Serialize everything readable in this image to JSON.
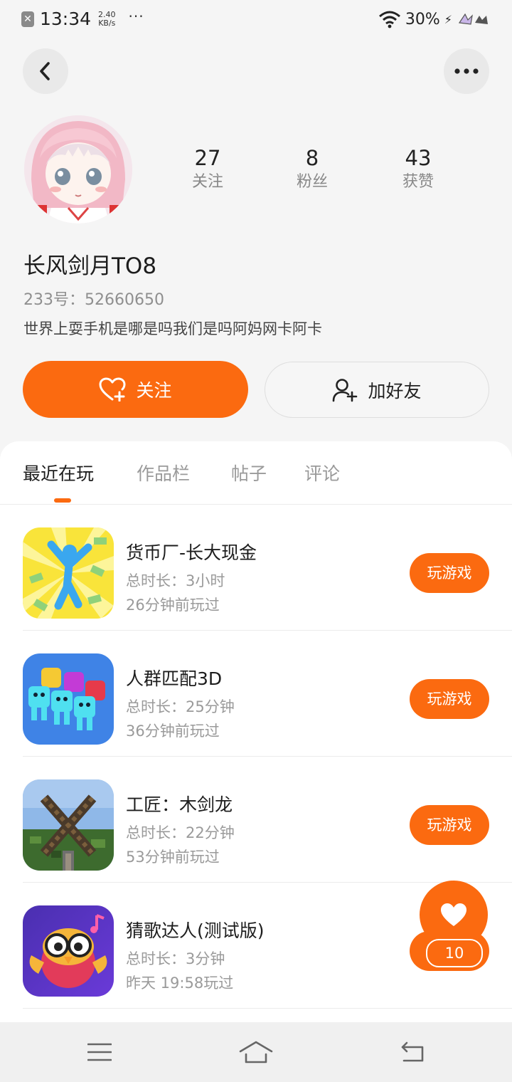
{
  "status_bar": {
    "time": "13:34",
    "speed_value": "2.40",
    "speed_unit": "KB/s",
    "more": "···",
    "battery": "30%"
  },
  "profile": {
    "stats": [
      {
        "value": "27",
        "label": "关注"
      },
      {
        "value": "8",
        "label": "粉丝"
      },
      {
        "value": "43",
        "label": "获赞"
      }
    ],
    "username": "长风剑月TO8",
    "uid": "233号：52660650",
    "bio": "世界上耍手机是哪是吗我们是吗阿妈网卡阿卡",
    "follow_label": "关注",
    "add_friend_label": "加好友"
  },
  "tabs": [
    "最近在玩",
    "作品栏",
    "帖子",
    "评论"
  ],
  "games": [
    {
      "name": "货币厂-长大现金",
      "duration": "总时长：3小时",
      "last_played": "26分钟前玩过",
      "button": "玩游戏"
    },
    {
      "name": "人群匹配3D",
      "duration": "总时长：25分钟",
      "last_played": "36分钟前玩过",
      "button": "玩游戏"
    },
    {
      "name": "工匠：木剑龙",
      "duration": "总时长：22分钟",
      "last_played": "53分钟前玩过",
      "button": "玩游戏"
    },
    {
      "name": "猜歌达人(测试版)",
      "duration": "总时长：3分钟",
      "last_played": "昨天 19:58玩过",
      "button": "玩游戏"
    }
  ],
  "like_count": "10",
  "colors": {
    "accent": "#fb6a10",
    "background": "#f5f5f5"
  }
}
